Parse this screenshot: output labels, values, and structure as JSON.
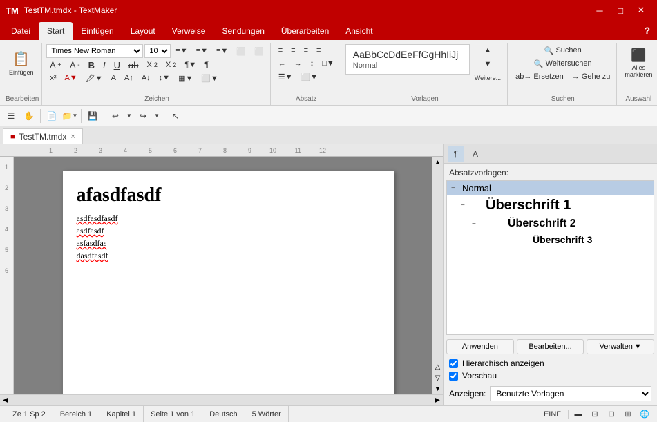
{
  "app": {
    "title": "TestTM.tmdx - TextMaker",
    "icon": "TM"
  },
  "titlebar": {
    "controls": [
      "minimize",
      "maximize",
      "close"
    ]
  },
  "ribbon": {
    "tabs": [
      {
        "id": "datei",
        "label": "Datei",
        "active": false
      },
      {
        "id": "start",
        "label": "Start",
        "active": true
      },
      {
        "id": "einfuegen",
        "label": "Einfügen",
        "active": false
      },
      {
        "id": "layout",
        "label": "Layout",
        "active": false
      },
      {
        "id": "verweise",
        "label": "Verweise",
        "active": false
      },
      {
        "id": "sendungen",
        "label": "Sendungen",
        "active": false
      },
      {
        "id": "ueberarbeiten",
        "label": "Überarbeiten",
        "active": false
      },
      {
        "id": "ansicht",
        "label": "Ansicht",
        "active": false
      }
    ],
    "groups": {
      "bearbeiten": {
        "label": "Bearbeiten"
      },
      "zeichen": {
        "label": "Zeichen"
      },
      "absatz": {
        "label": "Absatz"
      },
      "vorlagen": {
        "label": "Vorlagen"
      },
      "suchen": {
        "label": "Suchen"
      },
      "auswahl": {
        "label": "Auswahl"
      }
    },
    "font": {
      "name": "Times New Roman",
      "size": "10"
    },
    "style_preview": {
      "preview_text": "AaBbCcDdEeFfGgHhIiJj",
      "style_name": "Normal"
    },
    "buttons": {
      "suchen": "Suchen",
      "weitersuchen": "Weitersuchen",
      "ersetzen": "Ersetzen",
      "gehe_zu": "Gehe zu",
      "alles_markieren": "Alles\nmarkieren"
    }
  },
  "toolbar": {
    "buttons": [
      "menu",
      "hand",
      "new",
      "open",
      "save",
      "undo",
      "redo",
      "pointer"
    ]
  },
  "doc_tab": {
    "name": "TestTM.tmdx",
    "close": "×"
  },
  "document": {
    "heading": "afasdfasdf",
    "lines": [
      "asdfasdfasdf",
      "asdfasdf",
      "asfasdfas",
      "dasdfasdf"
    ]
  },
  "ruler": {
    "marks": [
      "1",
      "2",
      "3",
      "4",
      "5",
      "6",
      "7",
      "8",
      "9",
      "10",
      "11",
      "12"
    ]
  },
  "styles_panel": {
    "title": "Absatzvorlagen:",
    "toolbar_icons": [
      "paragraph",
      "font"
    ],
    "styles": [
      {
        "id": "normal",
        "label": "Normal",
        "level": 0,
        "class": "style-item-normal",
        "selected": true,
        "toggle": "−"
      },
      {
        "id": "h1",
        "label": "Überschrift 1",
        "level": 1,
        "class": "style-item-h1",
        "selected": false,
        "toggle": "−"
      },
      {
        "id": "h2",
        "label": "Überschrift 2",
        "level": 2,
        "class": "style-item-h2",
        "selected": false,
        "toggle": "−"
      },
      {
        "id": "h3",
        "label": "Überschrift 3",
        "level": 3,
        "class": "style-item-h3",
        "selected": false,
        "toggle": ""
      }
    ],
    "buttons": {
      "anwenden": "Anwenden",
      "bearbeiten": "Bearbeiten...",
      "verwalten": "Verwalten",
      "dropdown": "▼"
    },
    "options": {
      "hierarchisch": "Hierarchisch anzeigen",
      "vorschau": "Vorschau"
    },
    "filter": {
      "label": "Anzeigen:",
      "value": "Benutzte Vorlagen"
    }
  },
  "statusbar": {
    "ze": "Ze 1 Sp 2",
    "bereich": "Bereich 1",
    "kapitel": "Kapitel 1",
    "seite": "Seite 1 von 1",
    "sprache": "Deutsch",
    "woerter": "5 Wörter",
    "mode": "EINF",
    "views": [
      "normal",
      "outline",
      "layout1",
      "layout2",
      "web"
    ]
  }
}
